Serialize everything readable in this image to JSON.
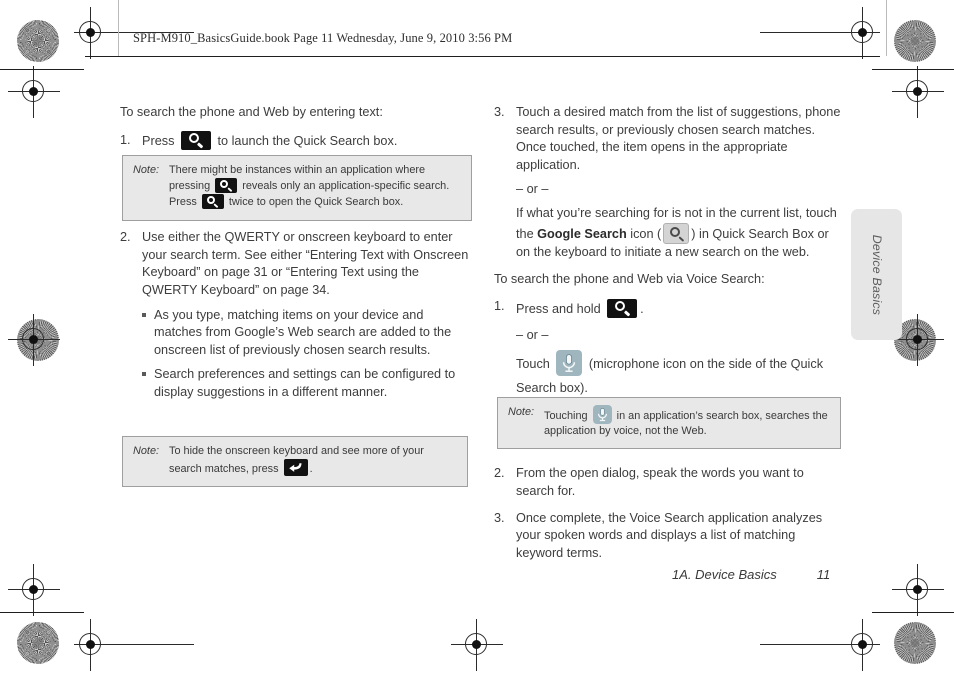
{
  "header": {
    "running_head": "SPH-M910_BasicsGuide.book  Page 11  Wednesday, June 9, 2010  3:56 PM"
  },
  "side_tab": {
    "label": "Device Basics"
  },
  "footer": {
    "section": "1A. Device Basics",
    "page_number": "11"
  },
  "left_column": {
    "lead": "To search the phone and Web by entering text:",
    "step1": {
      "num": "1.",
      "part_a": "Press",
      "part_b": "to launch the Quick Search box.",
      "icon": "search-key-icon"
    },
    "note1": {
      "label": "Note:",
      "part_a": "There might be instances within an application where pressing",
      "part_b": "reveals only an application-specific search. Press",
      "part_c": "twice to open the Quick Search box."
    },
    "step2": {
      "num": "2.",
      "text": "Use either the QWERTY or onscreen keyboard to enter your search term. See either “Entering Text with Onscreen Keyboard” on page 31 or “Entering Text using the QWERTY Keyboard” on page 34.",
      "bullets": [
        "As you type, matching items on your device and matches from Google’s Web search are added to the onscreen list of previously chosen search results.",
        "Search preferences and settings can be configured to display suggestions in a different manner."
      ]
    },
    "note2": {
      "label": "Note:",
      "part_a": "To hide the onscreen keyboard and see more of your search matches, press",
      "part_b": ".",
      "icon": "back-key-icon"
    }
  },
  "right_column": {
    "step3": {
      "num": "3.",
      "text": "Touch a desired match from the list of suggestions, phone search results, or previously chosen search matches. Once touched, the item opens in the appropriate application.",
      "or": "– or –",
      "alt_part_a": "If what you’re searching for is not in the current list, touch the",
      "alt_bold": "Google Search",
      "alt_part_b": "icon (",
      "alt_part_c": ") in Quick Search Box or on the keyboard to initiate a new search on the web.",
      "icon": "google-search-icon"
    },
    "voice_lead": "To search the phone and Web via Voice Search:",
    "vstep1": {
      "num": "1.",
      "part_a": "Press and hold",
      "part_b": ".",
      "or": "– or –",
      "touch_a": "Touch",
      "touch_b": "(microphone icon on the side of the Quick Search box).",
      "icon": "search-key-icon",
      "mic_icon": "microphone-icon"
    },
    "note1": {
      "label": "Note:",
      "part_a": "Touching",
      "part_b": "in an application’s search box, searches the application by voice, not the Web.",
      "icon": "microphone-icon"
    },
    "vstep2": {
      "num": "2.",
      "text": "From the open dialog, speak the words you want to search for."
    },
    "vstep3": {
      "num": "3.",
      "text": "Once complete, the Voice Search application analyzes your spoken words and displays a list of matching keyword terms."
    }
  },
  "colors": {
    "key_black": "#111111",
    "note_background": "#e8e8e8",
    "note_border": "#9f9f9f",
    "side_tab_background": "#e6e6e6",
    "mic_button": "#9fb6bf",
    "google_button": "#d4d4d4",
    "text": "#3d3d3d"
  }
}
